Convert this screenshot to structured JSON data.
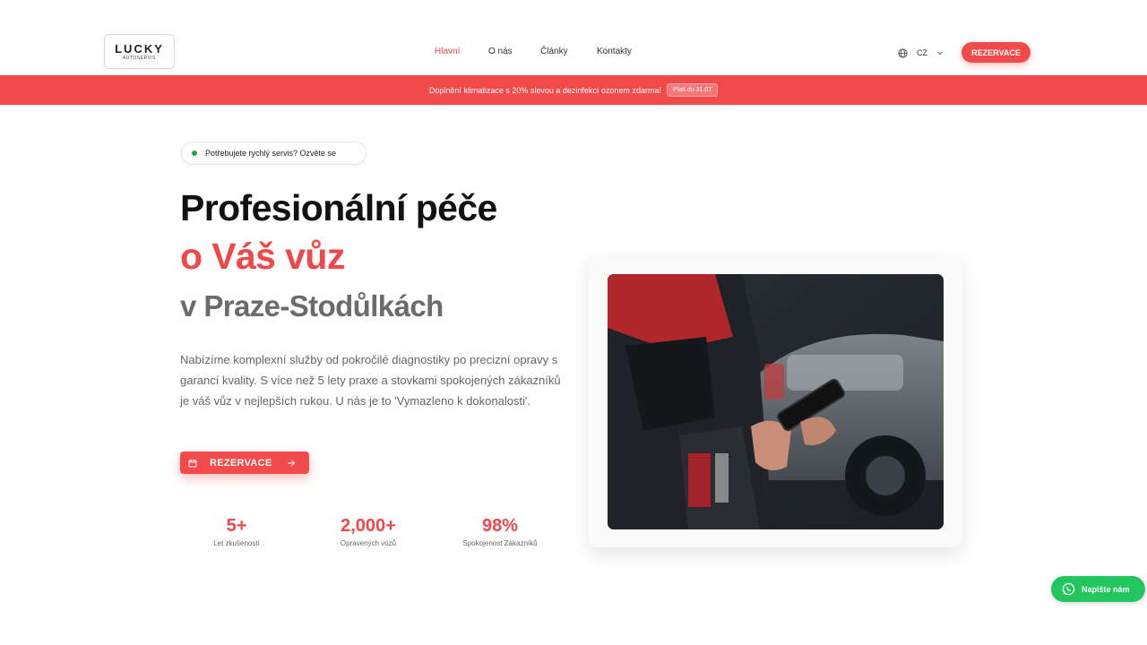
{
  "header": {
    "logo": {
      "name": "LUCKY",
      "sub": "AUTOSERVIS"
    },
    "nav": [
      {
        "label": "Hlavní",
        "active": true
      },
      {
        "label": "O nás",
        "active": false
      },
      {
        "label": "Články",
        "active": false
      },
      {
        "label": "Kontakty",
        "active": false
      }
    ],
    "language": "CZ",
    "reserve_button": "REZERVACE"
  },
  "promo": {
    "text": "Doplnění klimatizace s 20% slevou a dezinfekcí ozonem zdarma!",
    "badge": "Platí do 31.07"
  },
  "hero": {
    "pill_text": "Potřebujete rychlý servis? Ozvěte se",
    "title_line1": "Profesionální péče",
    "title_line2": "o Váš vůz",
    "title_line3": "v Praze-Stodůlkách",
    "description": "Nabízíme komplexní služby od pokročilé diagnostiky po precizní opravy s garancí kvality. S více než 5 lety praxe a stovkami spokojených zákazníků je váš vůz v nejlepších rukou. U nás je to 'Vymazleno k dokonalosti'.",
    "cta": "REZERVACE"
  },
  "stats": [
    {
      "value": "5+",
      "label": "Let zkušeností"
    },
    {
      "value": "2,000+",
      "label": "Opravených vozů"
    },
    {
      "value": "98%",
      "label": "Spokojenost Zákazníků"
    }
  ],
  "whatsapp": {
    "label": "Napište nám"
  },
  "colors": {
    "accent": "#f24a4a",
    "whatsapp": "#22c55e",
    "text": "#111111",
    "muted": "#666666"
  }
}
